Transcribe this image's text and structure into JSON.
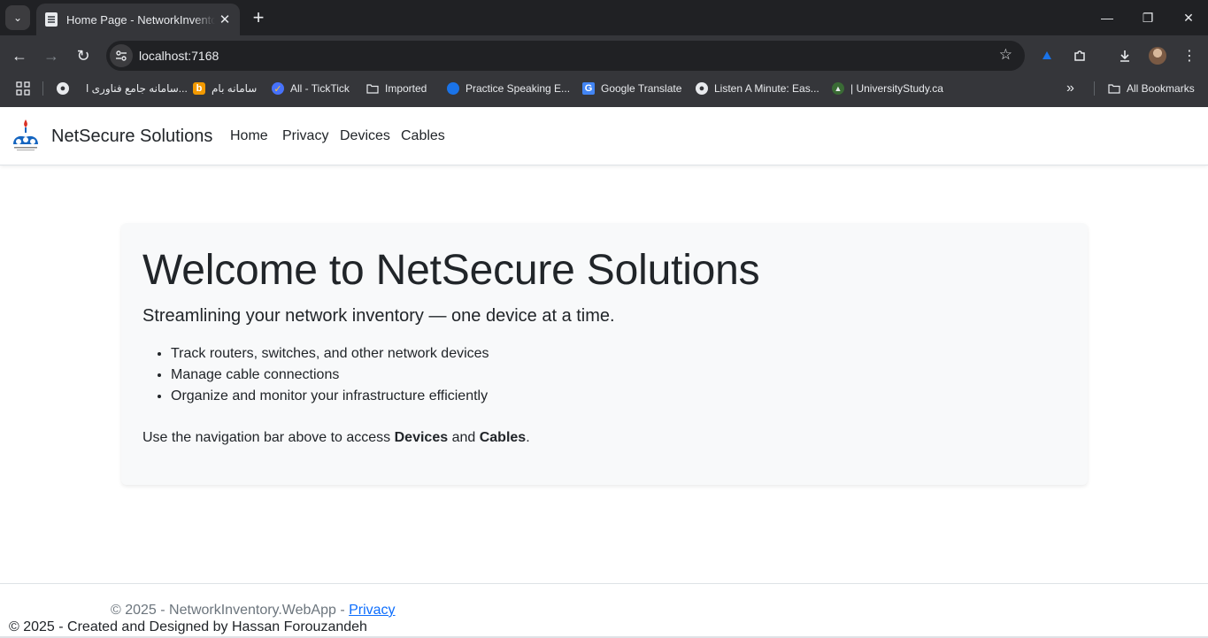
{
  "browser": {
    "tab_title": "Home Page - NetworkInventory.WebApp",
    "url": "localhost:7168",
    "bookmarks": [
      "سامانه جامع فناوری ا...",
      "سامانه بام",
      "All - TickTick",
      "Imported",
      "Practice Speaking E...",
      "Google Translate",
      "Listen A Minute: Eas...",
      "| UniversityStudy.ca"
    ],
    "all_bookmarks": "All Bookmarks",
    "overflow": "»"
  },
  "site": {
    "brand": "NetSecure Solutions",
    "nav": [
      "Home",
      "Privacy",
      "Devices",
      "Cables"
    ]
  },
  "hero": {
    "title": "Welcome to NetSecure Solutions",
    "lead": "Streamlining your network inventory — one device at a time.",
    "features": [
      "Track routers, switches, and other network devices",
      "Manage cable connections",
      "Organize and monitor your infrastructure efficiently"
    ],
    "cta": {
      "prefix": "Use the navigation bar above to access ",
      "devices": "Devices",
      "and": " and ",
      "cables": "Cables",
      "suffix": "."
    }
  },
  "footer": {
    "text": "© 2025 - NetworkInventory.WebApp - ",
    "privacy_link": "Privacy",
    "credit": "© 2025 - Created and Designed by Hassan Forouzandeh"
  },
  "colors": {
    "chrome_bg": "#35363a",
    "tabstrip_bg": "#202124",
    "hero_bg": "#f8f9fa",
    "link": "#0d6efd",
    "muted": "#6c757d"
  }
}
